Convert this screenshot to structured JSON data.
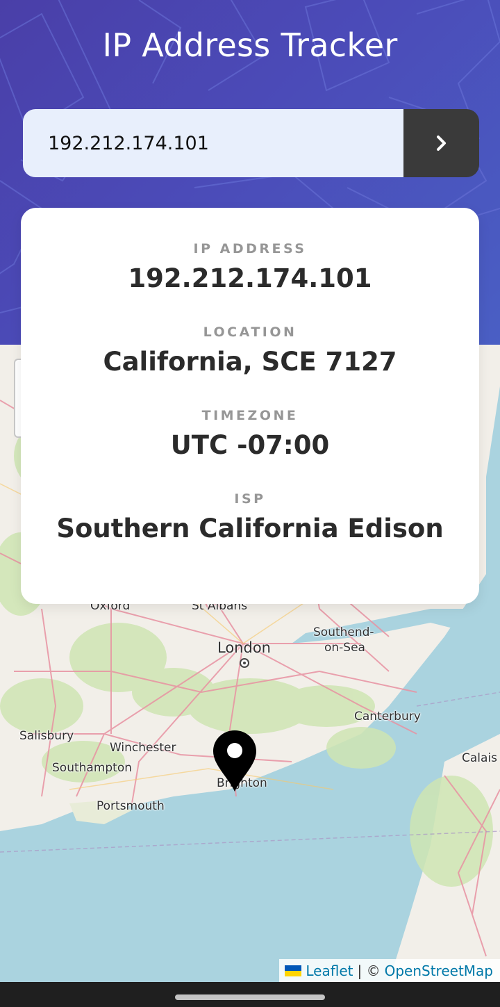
{
  "header": {
    "title": "IP Address Tracker",
    "gradient_colors": [
      "#4a3fa8",
      "#4b4bb8",
      "#4a5fc4"
    ]
  },
  "search": {
    "value": "192.212.174.101",
    "submit_icon": "chevron-right-icon"
  },
  "info": {
    "ip_label": "IP ADDRESS",
    "ip_value": "192.212.174.101",
    "location_label": "LOCATION",
    "location_value": "California, SCE 7127",
    "timezone_label": "TIMEZONE",
    "timezone_value": "UTC -07:00",
    "isp_label": "ISP",
    "isp_value": "Southern California Edison"
  },
  "map": {
    "labels": {
      "oxford": "Oxford",
      "st_albans": "St Albans",
      "southend": "Southend-",
      "on_sea": "on-Sea",
      "london": "London",
      "canterbury": "Canterbury",
      "salisbury": "Salisbury",
      "winchester": "Winchester",
      "southampton": "Southampton",
      "brighton": "Brighton",
      "portsmouth": "Portsmouth",
      "calais": "Calais"
    },
    "marker_icon": "location-pin-icon",
    "colors": {
      "sea": "#aad3df",
      "land": "#f2efe9",
      "green": "#cfe5b3",
      "roads": "#e892a2"
    }
  },
  "attribution": {
    "leaflet": "Leaflet",
    "separator": "| ©",
    "osm": "OpenStreetMap"
  }
}
